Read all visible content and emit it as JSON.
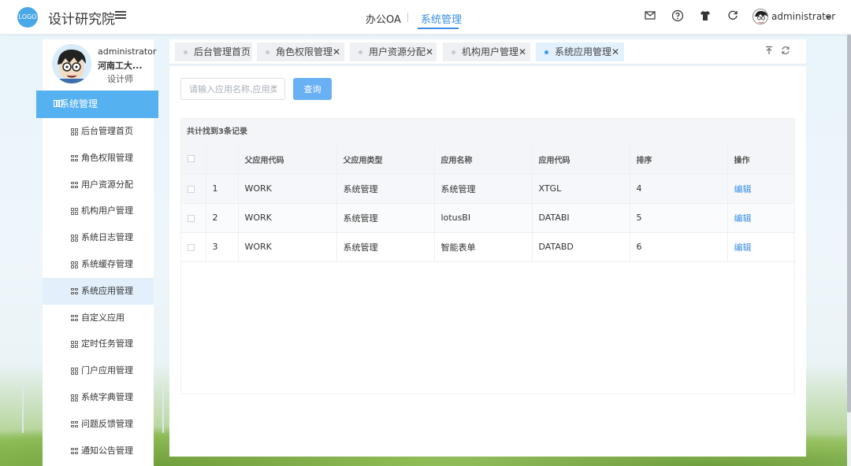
{
  "header": {
    "logo_text": "LOGO",
    "app_title": "设计研究院",
    "nav": [
      {
        "label": "办公OA",
        "active": false
      },
      {
        "label": "系统管理",
        "active": true
      }
    ],
    "icons": [
      "mail-icon",
      "help-icon",
      "tshirt-icon",
      "refresh-icon"
    ],
    "user_name": "administrator"
  },
  "sidebar": {
    "profile": {
      "name": "administrator",
      "org": "河南工大...",
      "role": "设计师"
    },
    "section_label": "系统管理",
    "items": [
      {
        "label": "后台管理首页",
        "active": false
      },
      {
        "label": "角色权限管理",
        "active": false
      },
      {
        "label": "用户资源分配",
        "active": false
      },
      {
        "label": "机构用户管理",
        "active": false
      },
      {
        "label": "系统日志管理",
        "active": false
      },
      {
        "label": "系统缓存管理",
        "active": false
      },
      {
        "label": "系统应用管理",
        "active": true
      },
      {
        "label": "自定义应用",
        "active": false
      },
      {
        "label": "定时任务管理",
        "active": false
      },
      {
        "label": "门户应用管理",
        "active": false
      },
      {
        "label": "系统字典管理",
        "active": false
      },
      {
        "label": "问题反馈管理",
        "active": false
      },
      {
        "label": "通知公告管理",
        "active": false
      }
    ]
  },
  "tabs": [
    {
      "label": "后台管理首页",
      "active": false
    },
    {
      "label": "角色权限管理✕",
      "active": false
    },
    {
      "label": "用户资源分配✕",
      "active": false
    },
    {
      "label": "机构用户管理✕",
      "active": false
    },
    {
      "label": "系统应用管理✕",
      "active": true
    }
  ],
  "search": {
    "placeholder": "请输入应用名称,应用类型",
    "value": "",
    "button_label": "查询"
  },
  "table": {
    "summary": "共计找到3条记录",
    "columns": [
      "",
      "",
      "父应用代码",
      "父应用类型",
      "应用名称",
      "应用代码",
      "排序",
      "操作"
    ],
    "rows": [
      {
        "index": "1",
        "parent_code": "WORK",
        "parent_type": "系统管理",
        "name": "系统管理",
        "code": "XTGL",
        "order": "4",
        "action": "编辑"
      },
      {
        "index": "2",
        "parent_code": "WORK",
        "parent_type": "系统管理",
        "name": "lotusBI",
        "code": "DATABI",
        "order": "5",
        "action": "编辑"
      },
      {
        "index": "3",
        "parent_code": "WORK",
        "parent_type": "系统管理",
        "name": "智能表单",
        "code": "DATABD",
        "order": "6",
        "action": "编辑"
      }
    ]
  },
  "colors": {
    "accent": "#3a8ee6",
    "sidebar_header": "#56b1f0",
    "query_button": "#6ab0f5"
  }
}
